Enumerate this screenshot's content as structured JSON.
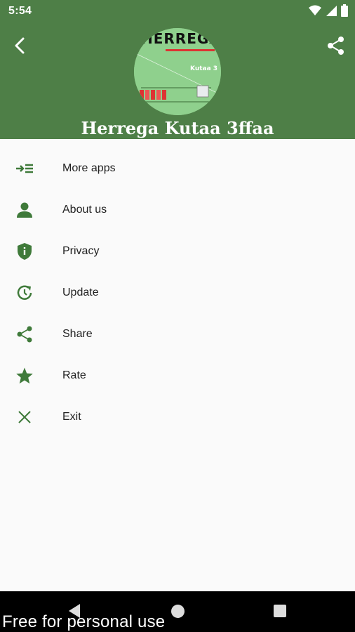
{
  "status_bar": {
    "time": "5:54",
    "icons": [
      "wifi-icon",
      "signal-icon",
      "battery-icon"
    ]
  },
  "header": {
    "title": "Herrega Kutaa 3ffaa",
    "logo_text": "HERREGA",
    "logo_subtitle": "Kutaa 3",
    "back_icon": "chevron-left-icon",
    "share_icon": "share-icon"
  },
  "menu": {
    "items": [
      {
        "label": "More apps",
        "icon": "more-apps-icon"
      },
      {
        "label": "About us",
        "icon": "person-icon"
      },
      {
        "label": "Privacy",
        "icon": "shield-icon"
      },
      {
        "label": "Update",
        "icon": "update-icon"
      },
      {
        "label": "Share",
        "icon": "share-icon"
      },
      {
        "label": "Rate",
        "icon": "star-icon"
      },
      {
        "label": "Exit",
        "icon": "close-icon"
      }
    ]
  },
  "nav": {
    "watermark": "Free for personal use"
  },
  "colors": {
    "primary": "#4e7f47",
    "icon": "#3f7a3a",
    "background": "#fafafa"
  }
}
